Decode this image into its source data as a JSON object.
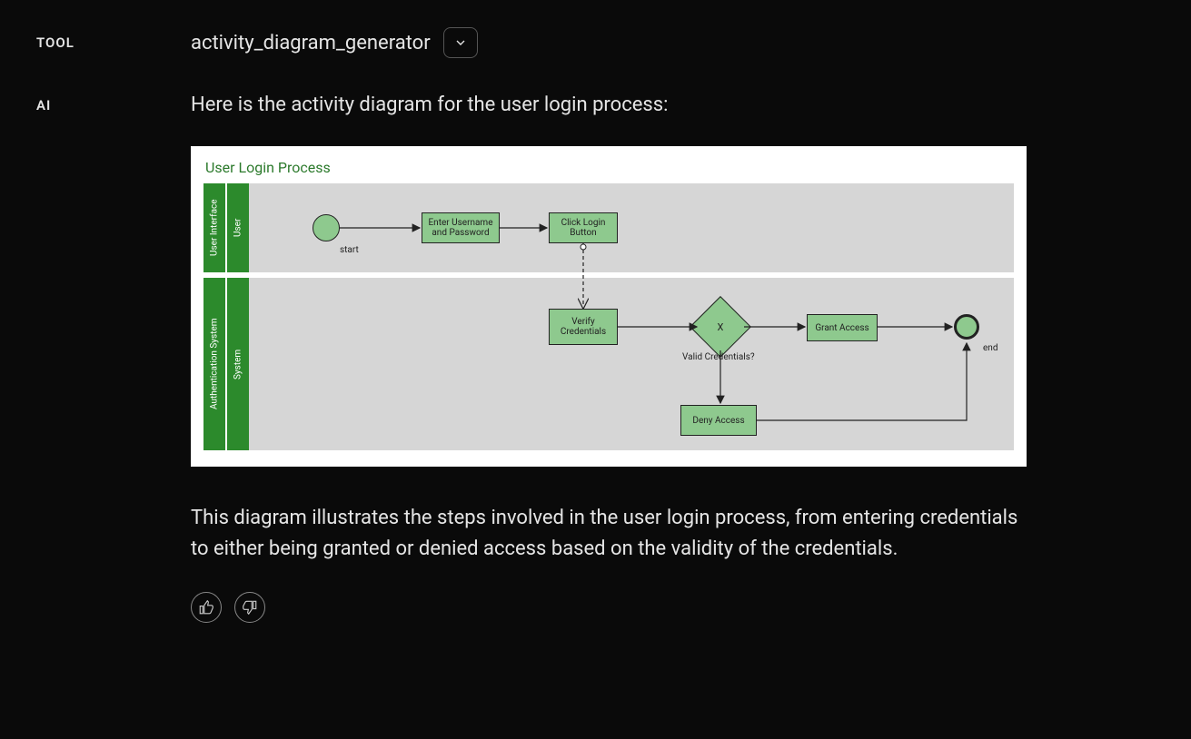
{
  "sections": {
    "tool_label": "TOOL",
    "ai_label": "AI"
  },
  "tool": {
    "name": "activity_diagram_generator"
  },
  "ai": {
    "intro": "Here is the activity diagram for the user login process:",
    "followup": "This diagram illustrates the steps involved in the user login process, from entering credentials to either being granted or denied access based on the validity of the credentials."
  },
  "diagram": {
    "title": "User Login Process",
    "lanes": [
      {
        "outer": "User Interface",
        "inner": "User"
      },
      {
        "outer": "Authentication System",
        "inner": "System"
      }
    ],
    "nodes": {
      "start_label": "start",
      "end_label": "end",
      "enter_creds": "Enter Username and Password",
      "click_login": "Click Login Button",
      "verify": "Verify Credentials",
      "decision_mark": "X",
      "decision_label": "Valid Credentials?",
      "grant": "Grant Access",
      "deny": "Deny Access"
    }
  }
}
